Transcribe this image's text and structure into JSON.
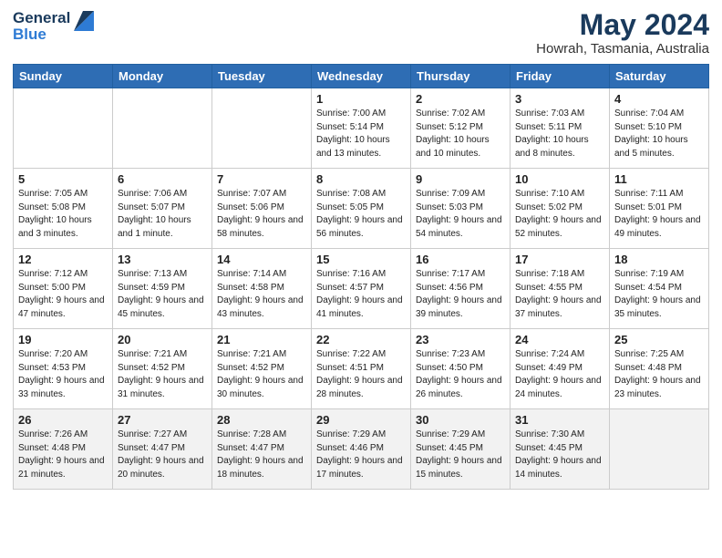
{
  "header": {
    "logo_line1": "General",
    "logo_line2": "Blue",
    "month": "May 2024",
    "location": "Howrah, Tasmania, Australia"
  },
  "days_of_week": [
    "Sunday",
    "Monday",
    "Tuesday",
    "Wednesday",
    "Thursday",
    "Friday",
    "Saturday"
  ],
  "weeks": [
    [
      {
        "day": "",
        "sunrise": "",
        "sunset": "",
        "daylight": ""
      },
      {
        "day": "",
        "sunrise": "",
        "sunset": "",
        "daylight": ""
      },
      {
        "day": "",
        "sunrise": "",
        "sunset": "",
        "daylight": ""
      },
      {
        "day": "1",
        "sunrise": "Sunrise: 7:00 AM",
        "sunset": "Sunset: 5:14 PM",
        "daylight": "Daylight: 10 hours and 13 minutes."
      },
      {
        "day": "2",
        "sunrise": "Sunrise: 7:02 AM",
        "sunset": "Sunset: 5:12 PM",
        "daylight": "Daylight: 10 hours and 10 minutes."
      },
      {
        "day": "3",
        "sunrise": "Sunrise: 7:03 AM",
        "sunset": "Sunset: 5:11 PM",
        "daylight": "Daylight: 10 hours and 8 minutes."
      },
      {
        "day": "4",
        "sunrise": "Sunrise: 7:04 AM",
        "sunset": "Sunset: 5:10 PM",
        "daylight": "Daylight: 10 hours and 5 minutes."
      }
    ],
    [
      {
        "day": "5",
        "sunrise": "Sunrise: 7:05 AM",
        "sunset": "Sunset: 5:08 PM",
        "daylight": "Daylight: 10 hours and 3 minutes."
      },
      {
        "day": "6",
        "sunrise": "Sunrise: 7:06 AM",
        "sunset": "Sunset: 5:07 PM",
        "daylight": "Daylight: 10 hours and 1 minute."
      },
      {
        "day": "7",
        "sunrise": "Sunrise: 7:07 AM",
        "sunset": "Sunset: 5:06 PM",
        "daylight": "Daylight: 9 hours and 58 minutes."
      },
      {
        "day": "8",
        "sunrise": "Sunrise: 7:08 AM",
        "sunset": "Sunset: 5:05 PM",
        "daylight": "Daylight: 9 hours and 56 minutes."
      },
      {
        "day": "9",
        "sunrise": "Sunrise: 7:09 AM",
        "sunset": "Sunset: 5:03 PM",
        "daylight": "Daylight: 9 hours and 54 minutes."
      },
      {
        "day": "10",
        "sunrise": "Sunrise: 7:10 AM",
        "sunset": "Sunset: 5:02 PM",
        "daylight": "Daylight: 9 hours and 52 minutes."
      },
      {
        "day": "11",
        "sunrise": "Sunrise: 7:11 AM",
        "sunset": "Sunset: 5:01 PM",
        "daylight": "Daylight: 9 hours and 49 minutes."
      }
    ],
    [
      {
        "day": "12",
        "sunrise": "Sunrise: 7:12 AM",
        "sunset": "Sunset: 5:00 PM",
        "daylight": "Daylight: 9 hours and 47 minutes."
      },
      {
        "day": "13",
        "sunrise": "Sunrise: 7:13 AM",
        "sunset": "Sunset: 4:59 PM",
        "daylight": "Daylight: 9 hours and 45 minutes."
      },
      {
        "day": "14",
        "sunrise": "Sunrise: 7:14 AM",
        "sunset": "Sunset: 4:58 PM",
        "daylight": "Daylight: 9 hours and 43 minutes."
      },
      {
        "day": "15",
        "sunrise": "Sunrise: 7:16 AM",
        "sunset": "Sunset: 4:57 PM",
        "daylight": "Daylight: 9 hours and 41 minutes."
      },
      {
        "day": "16",
        "sunrise": "Sunrise: 7:17 AM",
        "sunset": "Sunset: 4:56 PM",
        "daylight": "Daylight: 9 hours and 39 minutes."
      },
      {
        "day": "17",
        "sunrise": "Sunrise: 7:18 AM",
        "sunset": "Sunset: 4:55 PM",
        "daylight": "Daylight: 9 hours and 37 minutes."
      },
      {
        "day": "18",
        "sunrise": "Sunrise: 7:19 AM",
        "sunset": "Sunset: 4:54 PM",
        "daylight": "Daylight: 9 hours and 35 minutes."
      }
    ],
    [
      {
        "day": "19",
        "sunrise": "Sunrise: 7:20 AM",
        "sunset": "Sunset: 4:53 PM",
        "daylight": "Daylight: 9 hours and 33 minutes."
      },
      {
        "day": "20",
        "sunrise": "Sunrise: 7:21 AM",
        "sunset": "Sunset: 4:52 PM",
        "daylight": "Daylight: 9 hours and 31 minutes."
      },
      {
        "day": "21",
        "sunrise": "Sunrise: 7:21 AM",
        "sunset": "Sunset: 4:52 PM",
        "daylight": "Daylight: 9 hours and 30 minutes."
      },
      {
        "day": "22",
        "sunrise": "Sunrise: 7:22 AM",
        "sunset": "Sunset: 4:51 PM",
        "daylight": "Daylight: 9 hours and 28 minutes."
      },
      {
        "day": "23",
        "sunrise": "Sunrise: 7:23 AM",
        "sunset": "Sunset: 4:50 PM",
        "daylight": "Daylight: 9 hours and 26 minutes."
      },
      {
        "day": "24",
        "sunrise": "Sunrise: 7:24 AM",
        "sunset": "Sunset: 4:49 PM",
        "daylight": "Daylight: 9 hours and 24 minutes."
      },
      {
        "day": "25",
        "sunrise": "Sunrise: 7:25 AM",
        "sunset": "Sunset: 4:48 PM",
        "daylight": "Daylight: 9 hours and 23 minutes."
      }
    ],
    [
      {
        "day": "26",
        "sunrise": "Sunrise: 7:26 AM",
        "sunset": "Sunset: 4:48 PM",
        "daylight": "Daylight: 9 hours and 21 minutes."
      },
      {
        "day": "27",
        "sunrise": "Sunrise: 7:27 AM",
        "sunset": "Sunset: 4:47 PM",
        "daylight": "Daylight: 9 hours and 20 minutes."
      },
      {
        "day": "28",
        "sunrise": "Sunrise: 7:28 AM",
        "sunset": "Sunset: 4:47 PM",
        "daylight": "Daylight: 9 hours and 18 minutes."
      },
      {
        "day": "29",
        "sunrise": "Sunrise: 7:29 AM",
        "sunset": "Sunset: 4:46 PM",
        "daylight": "Daylight: 9 hours and 17 minutes."
      },
      {
        "day": "30",
        "sunrise": "Sunrise: 7:29 AM",
        "sunset": "Sunset: 4:45 PM",
        "daylight": "Daylight: 9 hours and 15 minutes."
      },
      {
        "day": "31",
        "sunrise": "Sunrise: 7:30 AM",
        "sunset": "Sunset: 4:45 PM",
        "daylight": "Daylight: 9 hours and 14 minutes."
      },
      {
        "day": "",
        "sunrise": "",
        "sunset": "",
        "daylight": ""
      }
    ]
  ]
}
